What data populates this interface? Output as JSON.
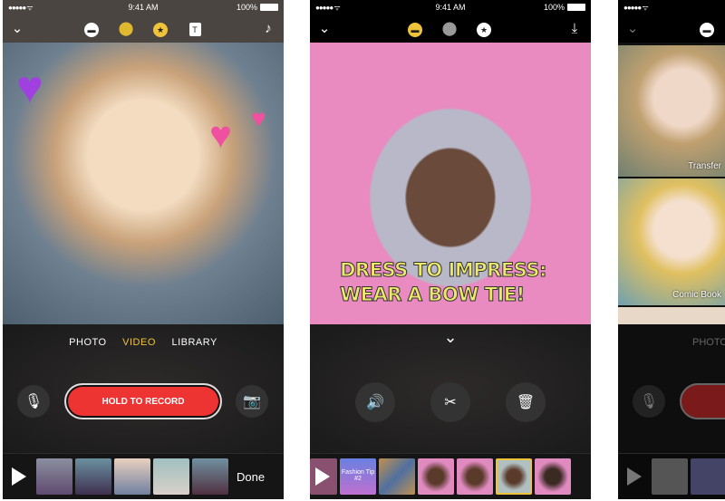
{
  "status": {
    "signal": "●●●●● ᯤ",
    "time": "9:41 AM",
    "battery": "100%"
  },
  "screen1": {
    "icons": [
      "chevron-down-icon",
      "speech-bubble-icon",
      "filters-icon",
      "star-icon",
      "text-icon",
      "music-note-icon"
    ],
    "modes": {
      "photo": "PHOTO",
      "video": "VIDEO",
      "library": "LIBRARY"
    },
    "record_label": "HOLD TO RECORD",
    "done_label": "Done",
    "accent": "#f0c43a",
    "record_color": "#ee3333"
  },
  "screen2": {
    "icons": [
      "chevron-down-icon",
      "speech-bubble-icon",
      "filters-icon",
      "star-icon",
      "download-icon"
    ],
    "caption_line1": "DRESS TO IMPRESS:",
    "caption_line2": "WEAR A BOW TIE!",
    "thumb_title": "Fashion Tip #2",
    "background": "#e98ac0"
  },
  "screen3": {
    "filters": [
      {
        "label": "Transfer"
      },
      {
        "label": "Comic Book"
      }
    ],
    "mode_label": "PHOTO"
  }
}
